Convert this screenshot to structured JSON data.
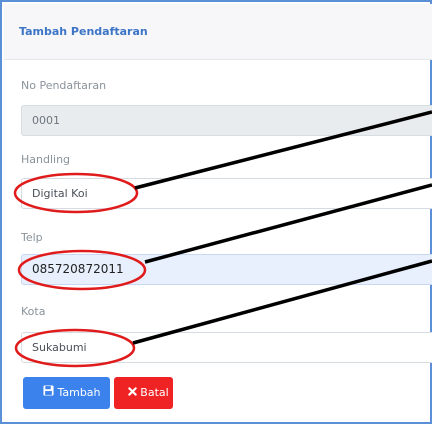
{
  "card": {
    "title": "Tambah Pendaftaran"
  },
  "form": {
    "no_pendaftaran": {
      "label": "No Pendaftaran",
      "value": "0001"
    },
    "handling": {
      "label": "Handling",
      "value": "Digital Koi"
    },
    "telp": {
      "label": "Telp",
      "value": "085720872011"
    },
    "kota": {
      "label": "Kota",
      "value": "Sukabumi"
    }
  },
  "actions": {
    "submit": {
      "label": "Tambah",
      "icon": "save-icon",
      "color": "#3b82ec"
    },
    "cancel": {
      "label": "Batal",
      "icon": "close-icon",
      "color": "#ef2323"
    }
  },
  "colors": {
    "accent": "#3c74c6",
    "annotation": "#e01b1b"
  }
}
